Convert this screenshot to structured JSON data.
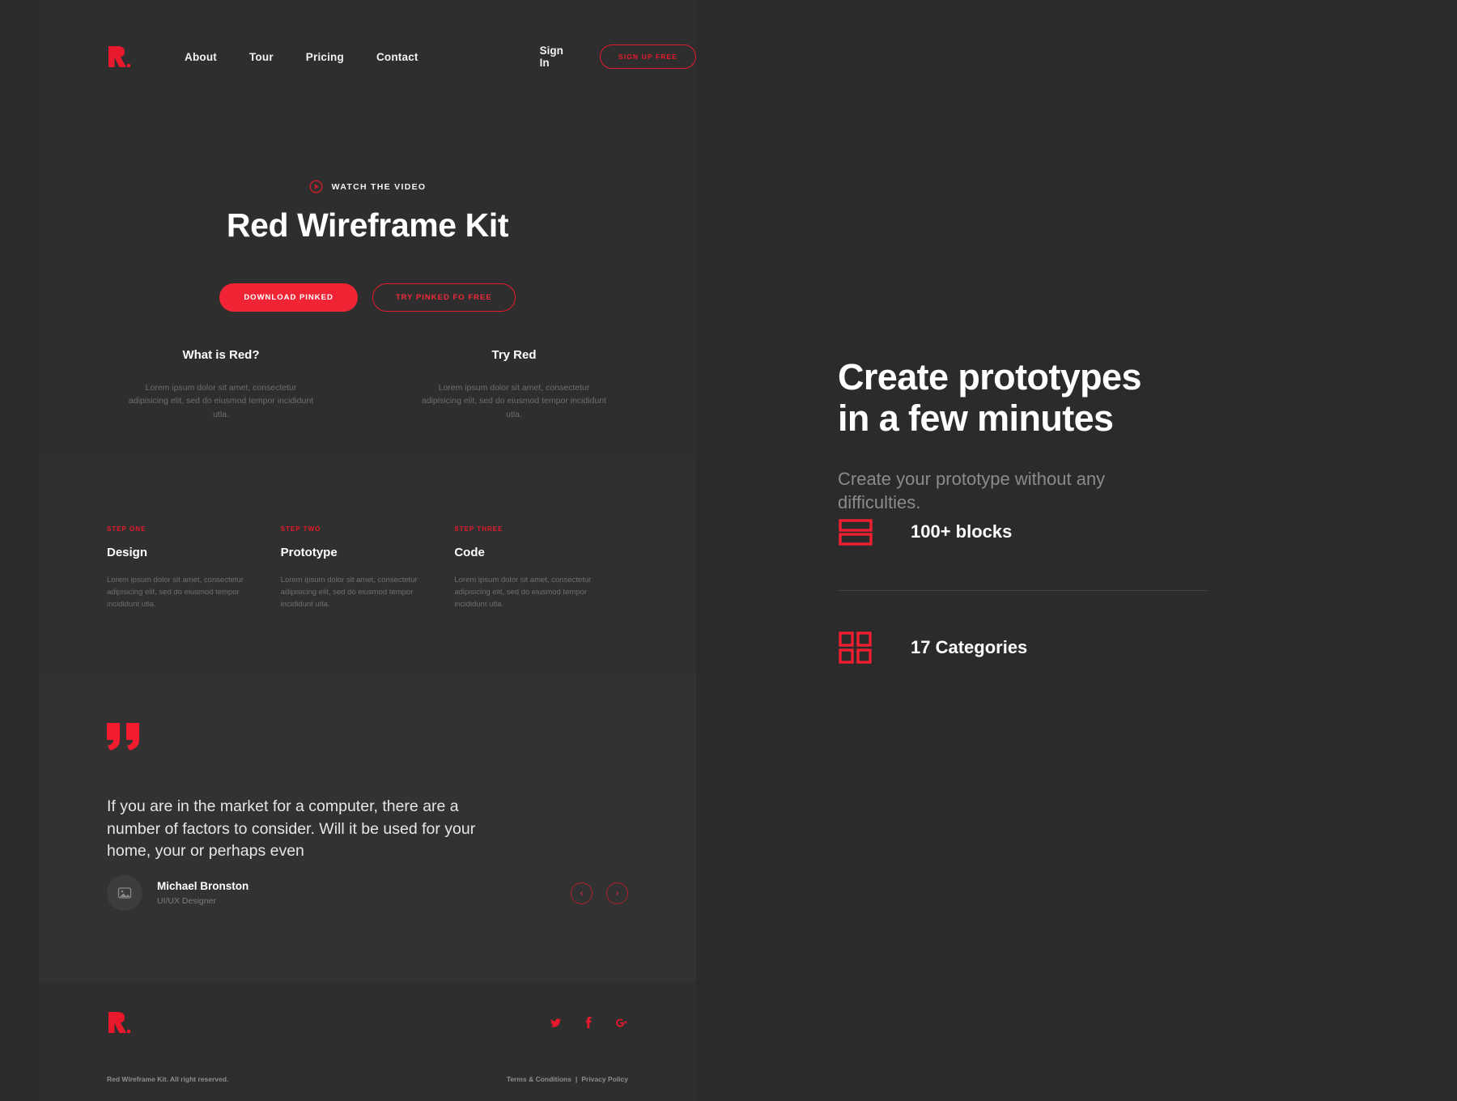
{
  "colors": {
    "accent": "#e8192c",
    "accent_bright": "#f02435",
    "page_bg": "#2b2b2b",
    "panel_bg": "#2e2e2e",
    "muted_text": "#6e6e6e"
  },
  "mockup": {
    "nav": {
      "logo_alt": "R",
      "links": [
        {
          "label": "About"
        },
        {
          "label": "Tour"
        },
        {
          "label": "Pricing"
        },
        {
          "label": "Contact"
        }
      ],
      "signin_label": "Sign In",
      "signup_label": "SIGN UP FREE"
    },
    "hero": {
      "watch_label": "WATCH THE VIDEO",
      "title": "Red Wireframe Kit",
      "primary_button": "DOWNLOAD PINKED",
      "secondary_button": "TRY PINKED FO FREE"
    },
    "two_columns": [
      {
        "title": "What is Red?",
        "body": "Lorem ipsum dolor sit amet, consectetur adipisicing elit, sed do eiusmod tempor incididunt utla."
      },
      {
        "title": "Try Red",
        "body": "Lorem ipsum dolor sit amet, consectetur adipisicing elit, sed do eiusmod tempor incididunt utla."
      }
    ],
    "steps": [
      {
        "kicker": "STEP ONE",
        "title": "Design",
        "body": "Lorem ipsum dolor sit amet, consectetur adipisicing elit, sed do eiusmod tempor incididunt utla."
      },
      {
        "kicker": "STEP TWO",
        "title": "Prototype",
        "body": "Lorem ipsum dolor sit amet, consectetur adipisicing elit, sed do eiusmod tempor incididunt utla."
      },
      {
        "kicker": "STEP THREE",
        "title": "Code",
        "body": "Lorem ipsum dolor sit amet, consectetur adipisicing elit, sed do eiusmod tempor incididunt utla."
      }
    ],
    "testimonial": {
      "quote": "If you are in the market for a computer, there are a number of factors to consider. Will it be used for your home, your or perhaps even",
      "author_name": "Michael Bronston",
      "author_role": "UI/UX Designer",
      "prev_label": "‹",
      "next_label": "›"
    },
    "footer": {
      "logo_alt": "R",
      "socials": [
        {
          "name": "twitter-icon"
        },
        {
          "name": "facebook-icon"
        },
        {
          "name": "google-plus-icon"
        }
      ],
      "copyright": "Red Wireframe Kit. All right reserved.",
      "terms_label": "Terms & Conditions",
      "separator": "|",
      "privacy_label": "Privacy Policy"
    }
  },
  "right_panel": {
    "title_line1": "Create prototypes",
    "title_line2": "in a few minutes",
    "subtitle": "Create your prototype without any difficulties.",
    "features": [
      {
        "icon": "rows-icon",
        "label": "100+ blocks"
      },
      {
        "icon": "grid-icon",
        "label": "17 Categories"
      }
    ]
  }
}
